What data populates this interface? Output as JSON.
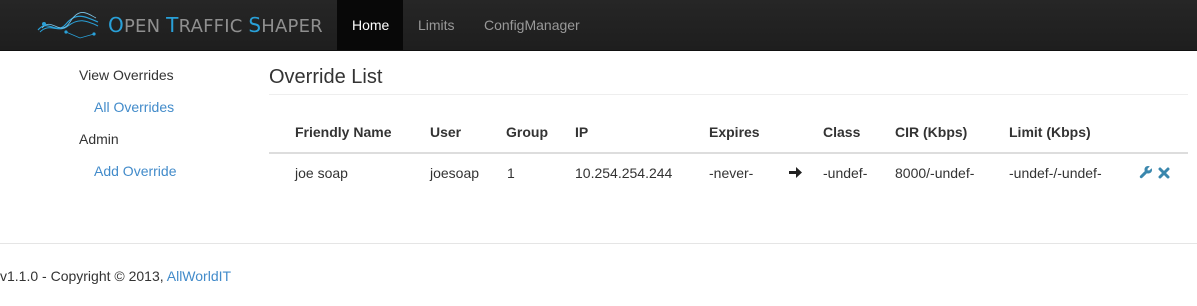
{
  "brand": {
    "logo_icon": "network-waves-logo",
    "title_parts": [
      {
        "cap": "O",
        "rest": "PEN "
      },
      {
        "cap": "T",
        "rest": "RAFFIC "
      },
      {
        "cap": "S",
        "rest": "HAPER"
      }
    ]
  },
  "nav": {
    "items": [
      {
        "label": "Home",
        "active": true
      },
      {
        "label": "Limits",
        "active": false
      },
      {
        "label": "ConfigManager",
        "active": false
      }
    ]
  },
  "sidebar": {
    "sections": [
      {
        "header": "View Overrides",
        "links": [
          "All Overrides"
        ]
      },
      {
        "header": "Admin",
        "links": [
          "Add Override"
        ]
      }
    ]
  },
  "main": {
    "title": "Override List",
    "columns": [
      "Friendly Name",
      "User",
      "Group",
      "IP",
      "Expires",
      "",
      "Class",
      "CIR (Kbps)",
      "Limit (Kbps)"
    ],
    "rows": [
      {
        "friendly_name": "joe soap",
        "user": "joesoap",
        "group": "1",
        "ip": "10.254.254.244",
        "expires": "-never-",
        "arrow_icon": "arrow-right-icon",
        "class": "-undef-",
        "cir": "8000/-undef-",
        "limit": "-undef-/-undef-",
        "actions": [
          "wrench-icon",
          "remove-icon"
        ]
      }
    ]
  },
  "footer": {
    "text": "v1.1.0 - Copyright © 2013, ",
    "link": "AllWorldIT"
  },
  "colors": {
    "navbar": "#222222",
    "brand_accent": "#29a0d8",
    "link": "#428bca",
    "action_icon": "#3a87ad"
  }
}
